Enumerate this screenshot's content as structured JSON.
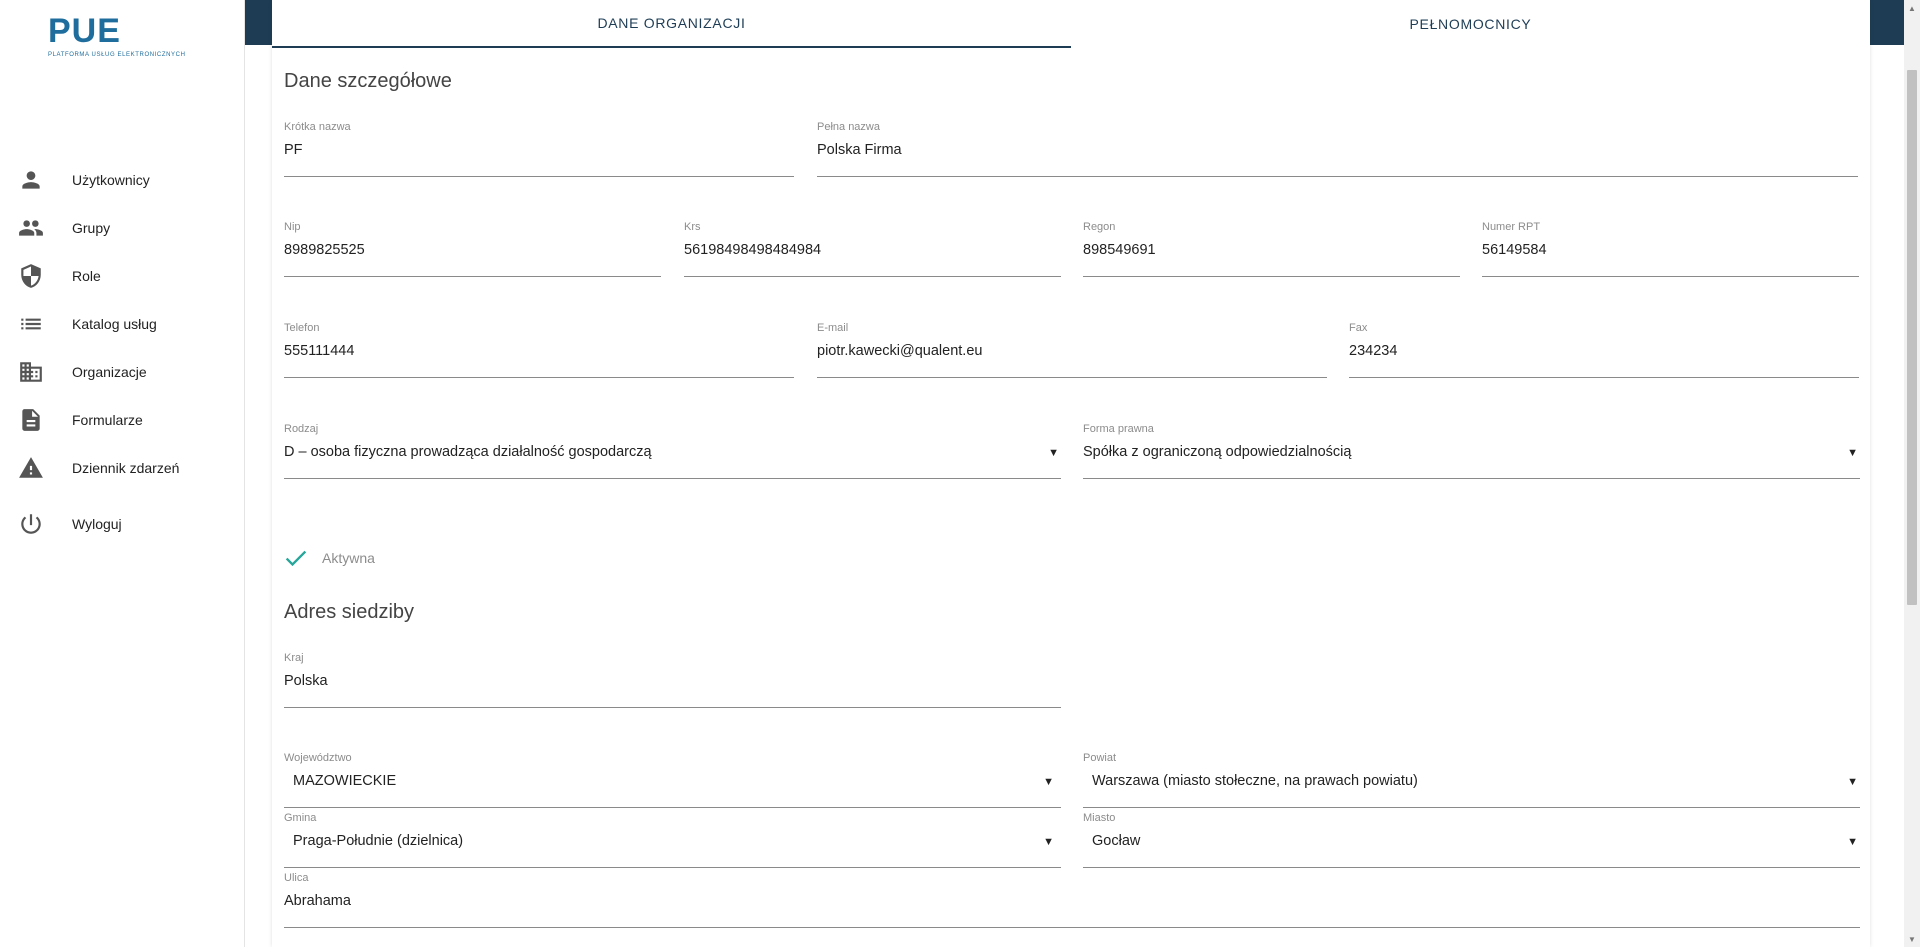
{
  "logo": {
    "title": "PUE",
    "subtitle": "PLATFORMA USŁUG ELEKTRONICZNYCH"
  },
  "nav": {
    "items": [
      {
        "label": "Użytkownicy",
        "icon": "person-icon"
      },
      {
        "label": "Grupy",
        "icon": "group-icon"
      },
      {
        "label": "Role",
        "icon": "shield-icon"
      },
      {
        "label": "Katalog usług",
        "icon": "list-icon"
      },
      {
        "label": "Organizacje",
        "icon": "building-icon"
      },
      {
        "label": "Formularze",
        "icon": "document-icon"
      },
      {
        "label": "Dziennik zdarzeń",
        "icon": "warning-icon"
      },
      {
        "label": "Wyloguj",
        "icon": "power-icon"
      }
    ]
  },
  "tabs": [
    {
      "label": "DANE ORGANIZACJI",
      "active": true
    },
    {
      "label": "PEŁNOMOCNICY",
      "active": false
    }
  ],
  "details": {
    "title": "Dane szczegółowe",
    "short_name": {
      "label": "Krótka nazwa",
      "value": "PF"
    },
    "full_name": {
      "label": "Pełna nazwa",
      "value": "Polska Firma"
    },
    "nip": {
      "label": "Nip",
      "value": "8989825525"
    },
    "krs": {
      "label": "Krs",
      "value": "56198498498484984"
    },
    "regon": {
      "label": "Regon",
      "value": "898549691"
    },
    "rpt": {
      "label": "Numer RPT",
      "value": "56149584"
    },
    "phone": {
      "label": "Telefon",
      "value": "555111444"
    },
    "email": {
      "label": "E-mail",
      "value": "piotr.kawecki@qualent.eu"
    },
    "fax": {
      "label": "Fax",
      "value": "234234"
    },
    "kind": {
      "label": "Rodzaj",
      "value": "D – osoba fizyczna prowadząca działalność gospodarczą"
    },
    "legal_form": {
      "label": "Forma prawna",
      "value": "Spółka z ograniczoną odpowiedzialnością"
    },
    "active": {
      "label": "Aktywna",
      "checked": true
    }
  },
  "address": {
    "title": "Adres siedziby",
    "country": {
      "label": "Kraj",
      "value": "Polska"
    },
    "voivodeship": {
      "label": "Województwo",
      "value": "MAZOWIECKIE"
    },
    "county": {
      "label": "Powiat",
      "value": "Warszawa (miasto stołeczne, na prawach powiatu)"
    },
    "commune": {
      "label": "Gmina",
      "value": "Praga-Południe (dzielnica)"
    },
    "city": {
      "label": "Miasto",
      "value": "Gocław"
    },
    "street": {
      "label": "Ulica",
      "value": "Abrahama"
    }
  },
  "colors": {
    "accent": "#1e3d55",
    "logo": "#1f6d9c",
    "check": "#26a69a"
  },
  "dropdown_glyph": "▼",
  "scroll": {
    "up": "▲",
    "down": "▼"
  }
}
